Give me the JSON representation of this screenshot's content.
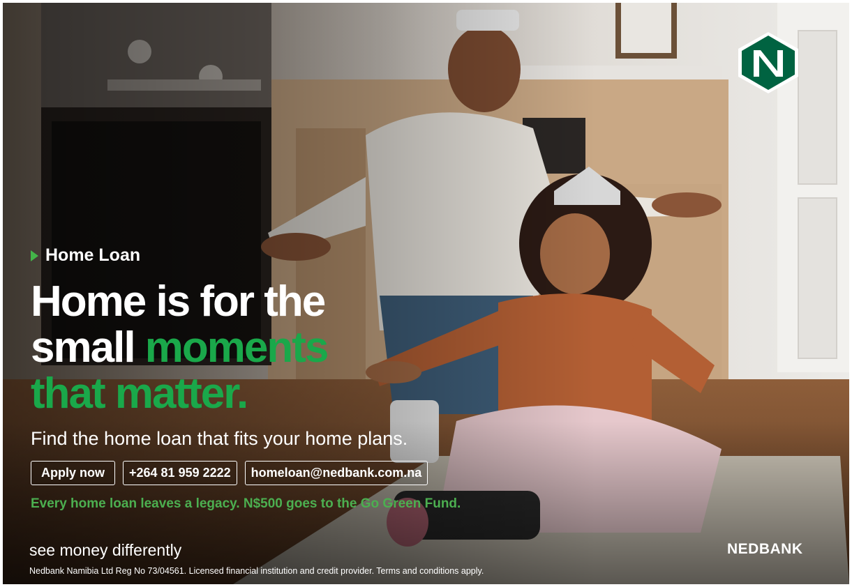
{
  "ad": {
    "eyebrow": "Home Loan",
    "headline": {
      "line1": "Home is for the",
      "line2_white": "small",
      "line2_green": "moments",
      "line3": "that matter."
    },
    "subline": "Find the home loan that fits your home plans.",
    "cta": {
      "apply": "Apply now",
      "phone": "+264 81 959 2222",
      "email": "homeloan@nedbank.com.na"
    },
    "legacy": "Every home loan leaves a legacy. N$500 goes to the Go Green Fund.",
    "tagline": "see money differently",
    "brand": "NEDBANK",
    "legal": "Nedbank Namibia Ltd Reg No 73/04561. Licensed financial institution and credit provider. Terms and conditions apply.",
    "colors": {
      "brand_green": "#006341",
      "accent_green": "#1aa84a",
      "legacy_green": "#4caf50"
    },
    "icons": {
      "logo": "nedbank-n-logo-icon",
      "bullet": "triangle-bullet-icon"
    }
  }
}
